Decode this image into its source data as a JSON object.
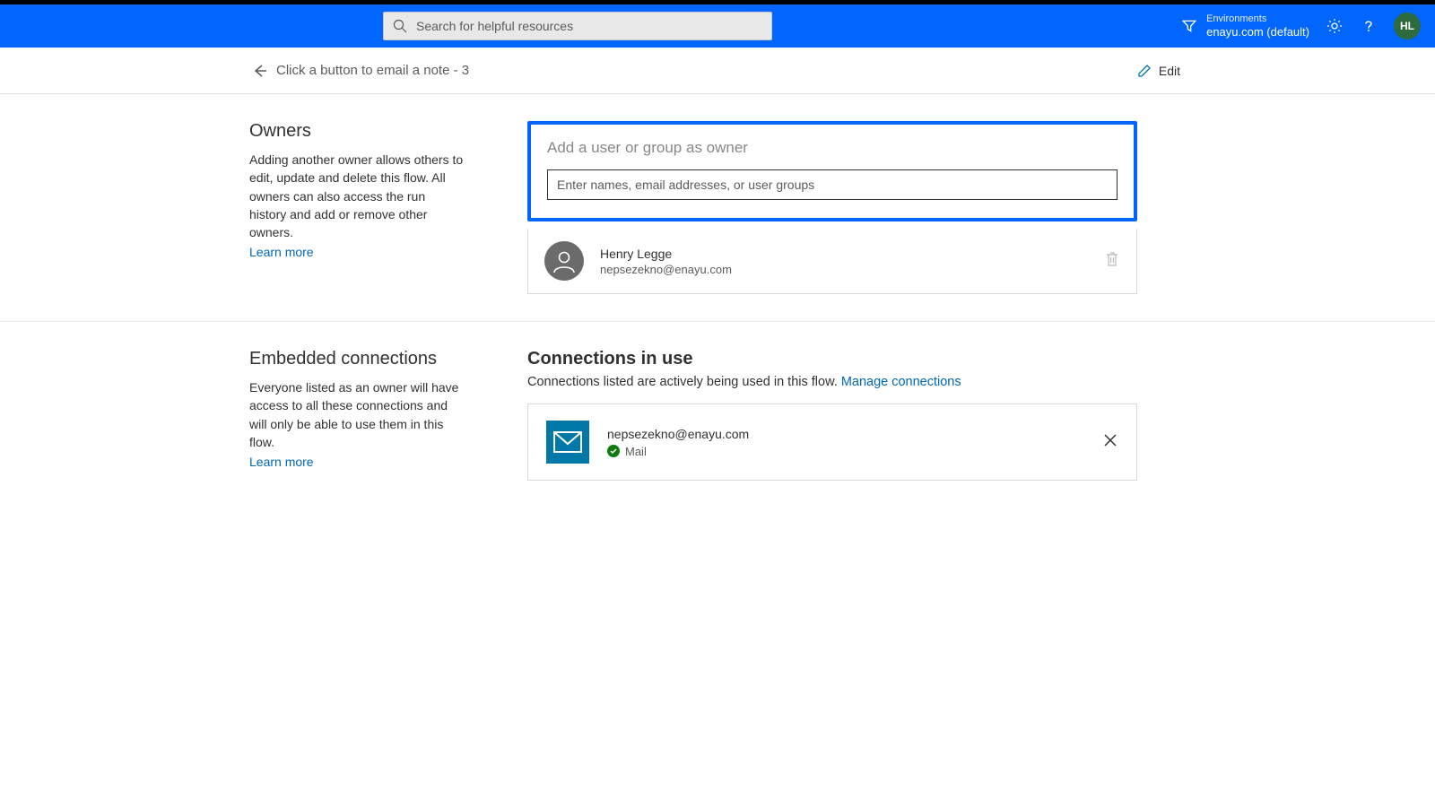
{
  "header": {
    "search_placeholder": "Search for helpful resources",
    "env_label": "Environments",
    "env_name": "enayu.com (default)",
    "avatar_initials": "HL"
  },
  "subheader": {
    "flow_title": "Click a button to email a note - 3",
    "edit_label": "Edit"
  },
  "owners_section": {
    "title": "Owners",
    "description": "Adding another owner allows others to edit, update and delete this flow. All owners can also access the run history and add or remove other owners.",
    "learn_more": "Learn more",
    "add_title": "Add a user or group as owner",
    "add_placeholder": "Enter names, email addresses, or user groups",
    "owner_name": "Henry Legge",
    "owner_email": "nepsezekno@enayu.com"
  },
  "connections_section": {
    "left_title": "Embedded connections",
    "left_desc": "Everyone listed as an owner will have access to all these connections and will only be able to use them in this flow.",
    "learn_more": "Learn more",
    "conn_title": "Connections in use",
    "conn_desc_prefix": "Connections listed are actively being used in this flow. ",
    "conn_link": "Manage connections",
    "conn_email": "nepsezekno@enayu.com",
    "conn_type": "Mail"
  }
}
